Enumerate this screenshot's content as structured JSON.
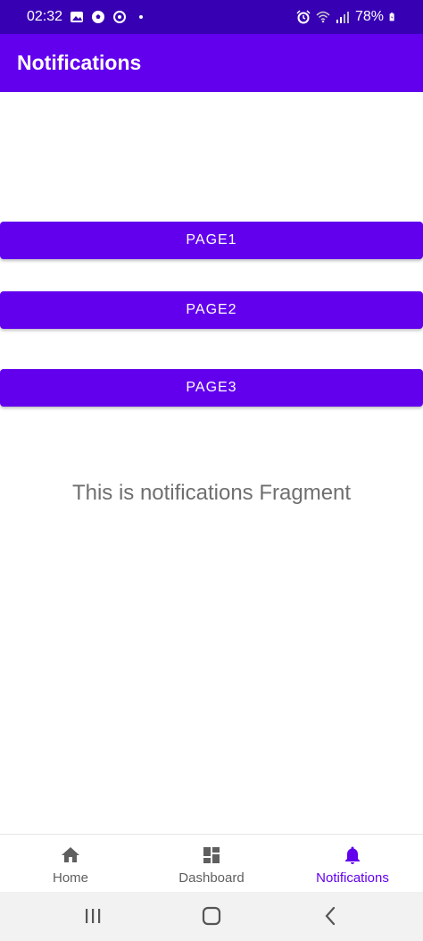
{
  "status_bar": {
    "time": "02:32",
    "battery": "78%"
  },
  "app_bar": {
    "title": "Notifications"
  },
  "buttons": [
    {
      "label": "PAGE1"
    },
    {
      "label": "PAGE2"
    },
    {
      "label": "PAGE3"
    }
  ],
  "fragment_text": "This is notifications Fragment",
  "bottom_nav": {
    "items": [
      {
        "label": "Home",
        "icon": "home-icon",
        "active": false
      },
      {
        "label": "Dashboard",
        "icon": "dashboard-icon",
        "active": false
      },
      {
        "label": "Notifications",
        "icon": "bell-icon",
        "active": true
      }
    ]
  },
  "colors": {
    "primary": "#6200ee",
    "primary_dark": "#3700b3",
    "inactive_nav": "#5f5f5f"
  }
}
